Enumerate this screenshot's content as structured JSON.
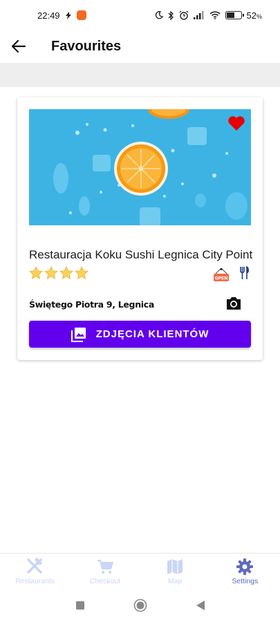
{
  "status_bar": {
    "time": "22:49",
    "battery": "52",
    "battery_unit": "%"
  },
  "header": {
    "title": "Favourites"
  },
  "restaurant": {
    "name": "Restauracja Koku Sushi Legnica City Point",
    "rating": 4,
    "address": "Świętego Piotra 9, Legnica",
    "open_badge": "OPEN",
    "favourite": true,
    "photos_button_label": "ZDJĘCIA KLIENTÓW"
  },
  "bottom_nav": {
    "items": [
      {
        "label": "Restaurants",
        "icon": "fork-knife-icon",
        "active": false
      },
      {
        "label": "Checkout",
        "icon": "cart-icon",
        "active": false
      },
      {
        "label": "Map",
        "icon": "map-icon",
        "active": false
      },
      {
        "label": "Settings",
        "icon": "gear-icon",
        "active": true
      }
    ]
  },
  "colors": {
    "accent": "#6200ee",
    "heart": "#e60000",
    "nav_inactive": "#c9d6f5",
    "nav_active": "#5c6bc0",
    "photo_bg": "#3db3e4"
  }
}
